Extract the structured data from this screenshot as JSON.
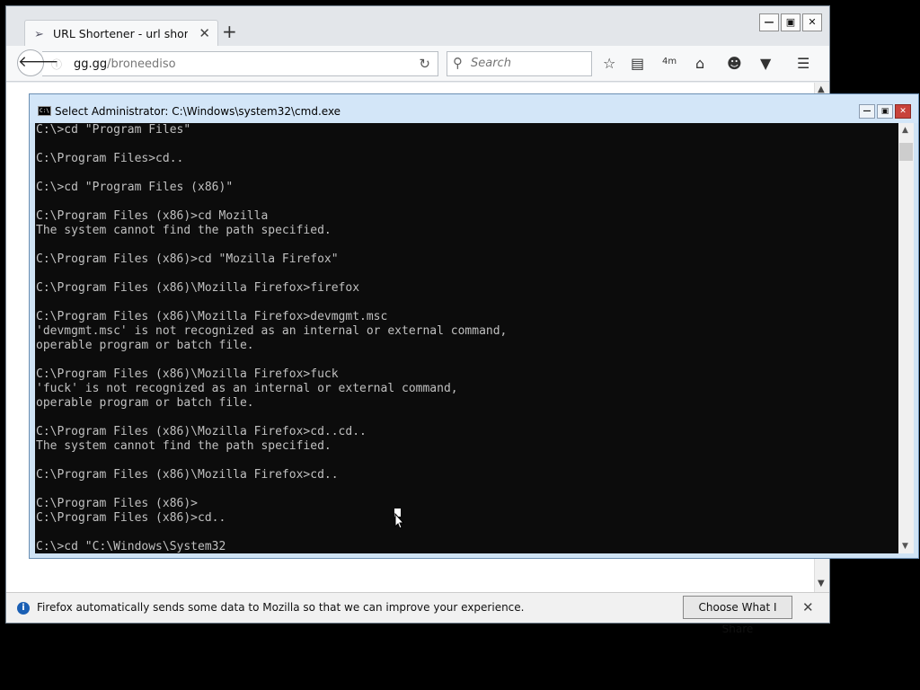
{
  "browser": {
    "tab_title": "URL Shortener - url shorte...",
    "new_tab_symbol": "+",
    "url_host": "gg.gg",
    "url_path": "/broneediso",
    "search_placeholder": "Search",
    "download_badge": "4m"
  },
  "notification": {
    "text": "Firefox automatically sends some data to Mozilla so that we can improve your experience.",
    "button": "Choose What I Share"
  },
  "cmd": {
    "title": "Select Administrator: C:\\Windows\\system32\\cmd.exe",
    "lines": [
      "C:\\>cd \"Program Files\"",
      "",
      "C:\\Program Files>cd..",
      "",
      "C:\\>cd \"Program Files (x86)\"",
      "",
      "C:\\Program Files (x86)>cd Mozilla",
      "The system cannot find the path specified.",
      "",
      "C:\\Program Files (x86)>cd \"Mozilla Firefox\"",
      "",
      "C:\\Program Files (x86)\\Mozilla Firefox>firefox",
      "",
      "C:\\Program Files (x86)\\Mozilla Firefox>devmgmt.msc",
      "'devmgmt.msc' is not recognized as an internal or external command,",
      "operable program or batch file.",
      "",
      "C:\\Program Files (x86)\\Mozilla Firefox>fuck",
      "'fuck' is not recognized as an internal or external command,",
      "operable program or batch file.",
      "",
      "C:\\Program Files (x86)\\Mozilla Firefox>cd..cd..",
      "The system cannot find the path specified.",
      "",
      "C:\\Program Files (x86)\\Mozilla Firefox>cd..",
      "",
      "C:\\Program Files (x86)>",
      "C:\\Program Files (x86)>cd..",
      "",
      "C:\\>cd \"C:\\Windows\\System32"
    ]
  },
  "colors": {
    "console_bg": "#0c0c0c",
    "console_text": "#c0c0c0",
    "cmd_frame": "#cfe3f5",
    "close_red": "#c8423a"
  },
  "icons": [
    "tab-favicon-icon",
    "back-arrow-icon",
    "info-icon",
    "reload-icon",
    "search-icon",
    "bookmark-star-icon",
    "reading-list-icon",
    "downloads-icon",
    "home-icon",
    "smiley-icon",
    "pocket-icon",
    "hamburger-menu-icon",
    "cmd-app-icon",
    "mouse-cursor-icon"
  ]
}
